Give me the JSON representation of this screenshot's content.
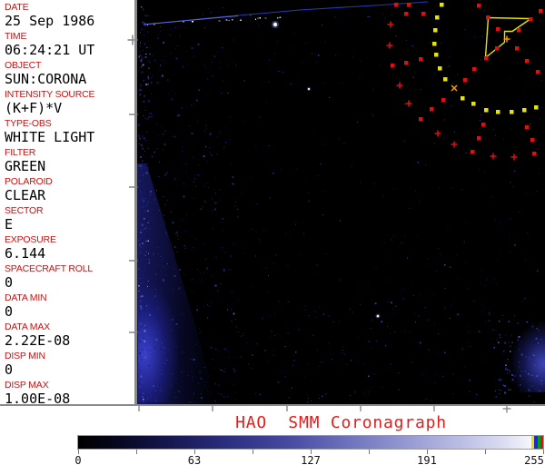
{
  "metadata_panel": {
    "label_color": "#c41414",
    "fields": [
      {
        "label": "DATE",
        "value": "25 Sep 1986"
      },
      {
        "label": "TIME",
        "value": "06:24:21 UT"
      },
      {
        "label": "OBJECT",
        "value": "SUN:CORONA"
      },
      {
        "label": "INTENSITY SOURCE",
        "value": "(K+F)*V"
      },
      {
        "label": "TYPE-OBS",
        "value": "WHITE LIGHT"
      },
      {
        "label": "FILTER",
        "value": "GREEN"
      },
      {
        "label": "POLAROID",
        "value": "CLEAR"
      },
      {
        "label": "SECTOR",
        "value": "E"
      },
      {
        "label": "EXPOSURE",
        "value": "6.144"
      },
      {
        "label": "SPACECRAFT ROLL",
        "value": "0"
      },
      {
        "label": "DATA MIN",
        "value": "0"
      },
      {
        "label": "DATA MAX",
        "value": "2.22E-08"
      },
      {
        "label": "DISP MIN",
        "value": "0"
      },
      {
        "label": "DISP MAX",
        "value": "1.00E-08"
      }
    ]
  },
  "caption": {
    "text": "HAO  SMM Coronagraph",
    "color": "#e41c1c"
  },
  "colorbar": {
    "tick_labels": [
      "0",
      "63",
      "127",
      "191",
      "255"
    ],
    "gradient_stops": [
      [
        0,
        "#000000"
      ],
      [
        8,
        "#06061e"
      ],
      [
        20,
        "#171852"
      ],
      [
        32,
        "#2c2e80"
      ],
      [
        45,
        "#4649a0"
      ],
      [
        58,
        "#6e72bc"
      ],
      [
        70,
        "#9397d1"
      ],
      [
        82,
        "#babde3"
      ],
      [
        92,
        "#dddef2"
      ],
      [
        97,
        "#f4f4fb"
      ],
      [
        100,
        "#fdfdff"
      ]
    ],
    "end_stripes": [
      "#e8e400",
      "#2228d8",
      "#00a018",
      "#d81414"
    ]
  },
  "overlay": {
    "colors": {
      "red": "#e01010",
      "yellow": "#e8e400",
      "orange": "#ff9900",
      "fiducial": "#8a8a8a"
    },
    "red_squares": [
      [
        436,
        5
      ],
      [
        450,
        5
      ],
      [
        447,
        15
      ],
      [
        466,
        15
      ],
      [
        527,
        6
      ],
      [
        595,
        12
      ],
      [
        537,
        19
      ],
      [
        584,
        21
      ],
      [
        548,
        32
      ],
      [
        571,
        33
      ],
      [
        432,
        72
      ],
      [
        547,
        53
      ],
      [
        569,
        53
      ],
      [
        535,
        64
      ],
      [
        447,
        69
      ],
      [
        463,
        65
      ],
      [
        522,
        76
      ],
      [
        580,
        67
      ],
      [
        592,
        79
      ],
      [
        512,
        88
      ],
      [
        488,
        110
      ],
      [
        475,
        120
      ],
      [
        463,
        131
      ],
      [
        532,
        137
      ],
      [
        580,
        140
      ],
      [
        527,
        152
      ],
      [
        520,
        167
      ],
      [
        586,
        154
      ],
      [
        588,
        169
      ]
    ],
    "yellow_squares": [
      [
        486,
        5
      ],
      [
        481,
        19
      ],
      [
        479,
        33
      ],
      [
        478,
        48
      ],
      [
        480,
        60
      ],
      [
        484,
        75
      ],
      [
        490,
        87
      ],
      [
        509,
        108
      ],
      [
        521,
        114
      ],
      [
        535,
        121
      ],
      [
        548,
        123
      ],
      [
        563,
        123
      ],
      [
        577,
        121
      ],
      [
        590,
        118
      ]
    ],
    "red_plus": [
      [
        430,
        27
      ],
      [
        429,
        50
      ],
      [
        440,
        94
      ],
      [
        450,
        114
      ],
      [
        482,
        147
      ],
      [
        500,
        159
      ],
      [
        543,
        172
      ],
      [
        566,
        173
      ]
    ],
    "orange_plus": [
      [
        558,
        43
      ]
    ],
    "orange_x": [
      [
        500,
        97
      ]
    ],
    "polygon": {
      "color": "#e8e400",
      "points": [
        [
          537.5,
          19.5
        ],
        [
          584.5,
          20.5
        ],
        [
          564,
          34.5
        ],
        [
          555.5,
          34.5
        ],
        [
          555.5,
          46.5
        ],
        [
          534.5,
          63.5
        ]
      ]
    }
  },
  "image": {
    "bright_spots": [
      [
        303,
        27,
        2.2
      ],
      [
        340,
        98,
        1.1
      ],
      [
        416,
        348,
        1.3
      ]
    ],
    "fiducials": {
      "left_plus": [
        146,
        44
      ],
      "left_dash_ys": [
        126,
        206,
        287,
        366
      ],
      "bottom_tick_xs": [
        153,
        234,
        316,
        397,
        478
      ],
      "bottom_plus": [
        558,
        450
      ]
    }
  }
}
